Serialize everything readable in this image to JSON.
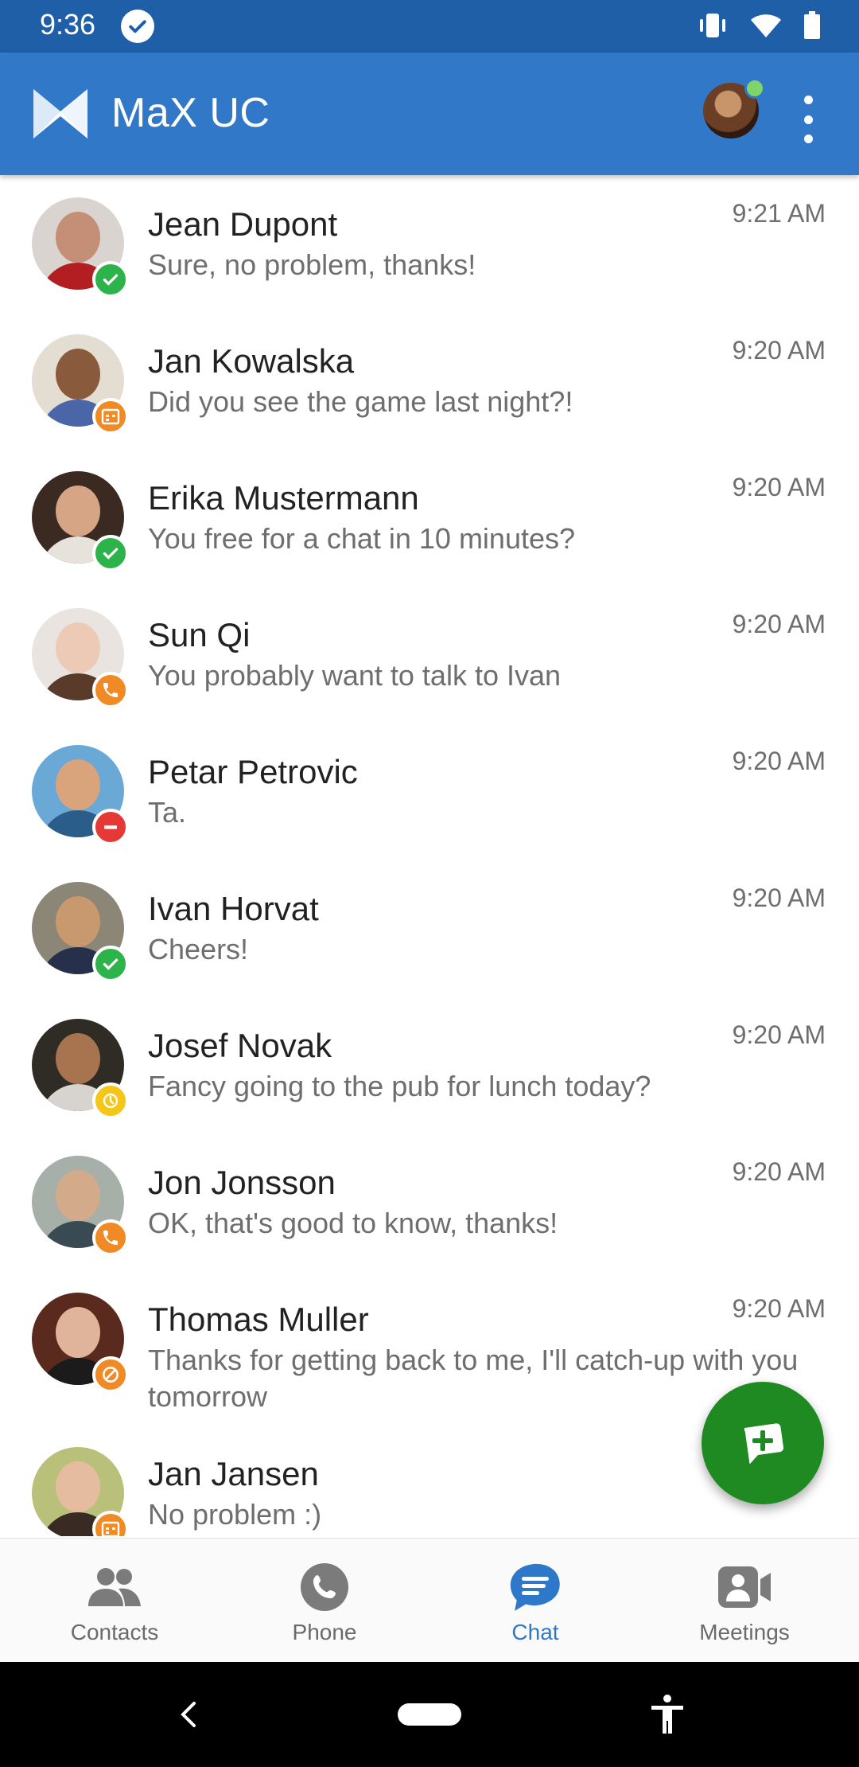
{
  "status_bar": {
    "time": "9:36"
  },
  "app_bar": {
    "title": "MaX UC"
  },
  "colors": {
    "app_bar": "#3178c9",
    "status_bar": "#1e5fa8",
    "online": "#2cb34a",
    "busy": "#e53935",
    "away": "#f2a134",
    "dnd_call": "#f08a24",
    "fab": "#1e8a21",
    "active_tab": "#2e78c9"
  },
  "chats": [
    {
      "name": "Jean Dupont",
      "message": "Sure, no problem, thanks!",
      "time": "9:21 AM",
      "presence": "online"
    },
    {
      "name": "Jan Kowalska",
      "message": "Did you see the game last night?!",
      "time": "9:20 AM",
      "presence": "meeting"
    },
    {
      "name": "Erika Mustermann",
      "message": "You free for a chat in 10 minutes?",
      "time": "9:20 AM",
      "presence": "online"
    },
    {
      "name": "Sun Qi",
      "message": "You probably want to talk to Ivan",
      "time": "9:20 AM",
      "presence": "on-call"
    },
    {
      "name": "Petar Petrovic",
      "message": "Ta.",
      "time": "9:20 AM",
      "presence": "busy"
    },
    {
      "name": "Ivan Horvat",
      "message": "Cheers!",
      "time": "9:20 AM",
      "presence": "online"
    },
    {
      "name": "Josef Novak",
      "message": "Fancy going to the pub for lunch today?",
      "time": "9:20 AM",
      "presence": "away"
    },
    {
      "name": "Jon Jonsson",
      "message": "OK, that's good to know, thanks!",
      "time": "9:20 AM",
      "presence": "on-call"
    },
    {
      "name": "Thomas Muller",
      "message": "Thanks for getting back to me, I'll catch-up with you tomorrow",
      "time": "9:20 AM",
      "presence": "do-not-disturb"
    },
    {
      "name": "Jan Jansen",
      "message": "No problem :)",
      "time": "",
      "presence": "meeting"
    }
  ],
  "nav": {
    "tabs": [
      {
        "label": "Contacts",
        "icon": "contacts-icon"
      },
      {
        "label": "Phone",
        "icon": "phone-icon"
      },
      {
        "label": "Chat",
        "icon": "chat-icon",
        "active": true
      },
      {
        "label": "Meetings",
        "icon": "meetings-icon"
      }
    ]
  }
}
